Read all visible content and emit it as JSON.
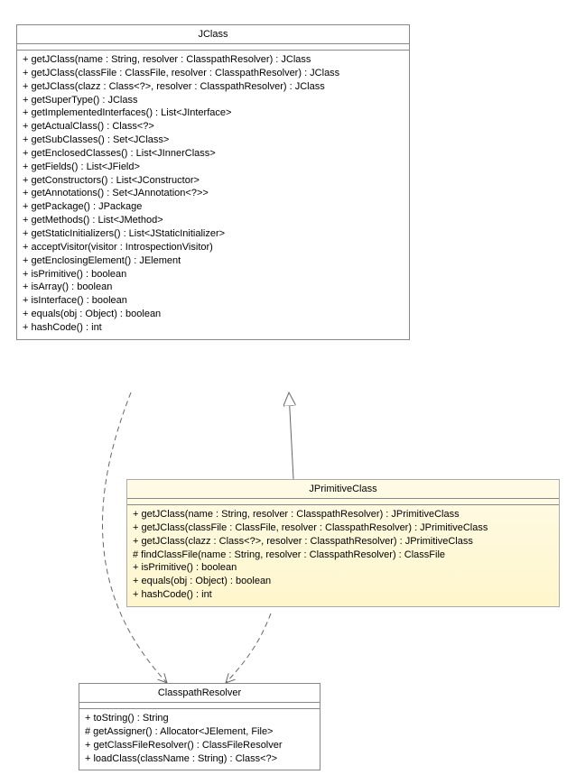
{
  "classes": {
    "jclass": {
      "name": "JClass",
      "ops": [
        "+ getJClass(name : String, resolver : ClasspathResolver) : JClass",
        "+ getJClass(classFile : ClassFile, resolver : ClasspathResolver) : JClass",
        "+ getJClass(clazz : Class<?>, resolver : ClasspathResolver) : JClass",
        "+ getSuperType() : JClass",
        "+ getImplementedInterfaces() : List<JInterface>",
        "+ getActualClass() : Class<?>",
        "+ getSubClasses() : Set<JClass>",
        "+ getEnclosedClasses() : List<JInnerClass>",
        "+ getFields() : List<JField>",
        "+ getConstructors() : List<JConstructor>",
        "+ getAnnotations() : Set<JAnnotation<?>>",
        "+ getPackage() : JPackage",
        "+ getMethods() : List<JMethod>",
        "+ getStaticInitializers() : List<JStaticInitializer>",
        "+ acceptVisitor(visitor : IntrospectionVisitor)",
        "+ getEnclosingElement() : JElement",
        "+ isPrimitive() : boolean",
        "+ isArray() : boolean",
        "+ isInterface() : boolean",
        "+ equals(obj : Object) : boolean",
        "+ hashCode() : int"
      ]
    },
    "jprimitiveclass": {
      "name": "JPrimitiveClass",
      "ops": [
        "+ getJClass(name : String, resolver : ClasspathResolver) : JPrimitiveClass",
        "+ getJClass(classFile : ClassFile, resolver : ClasspathResolver) : JPrimitiveClass",
        "+ getJClass(clazz : Class<?>, resolver : ClasspathResolver) : JPrimitiveClass",
        "# findClassFile(name : String, resolver : ClasspathResolver) : ClassFile",
        "+ isPrimitive() : boolean",
        "+ equals(obj : Object) : boolean",
        "+ hashCode() : int"
      ]
    },
    "classpathresolver": {
      "name": "ClasspathResolver",
      "ops": [
        "+ toString() : String",
        "# getAssigner() : Allocator<JElement, File>",
        "+ getClassFileResolver() : ClassFileResolver",
        "+ loadClass(className : String) : Class<?>"
      ]
    }
  }
}
